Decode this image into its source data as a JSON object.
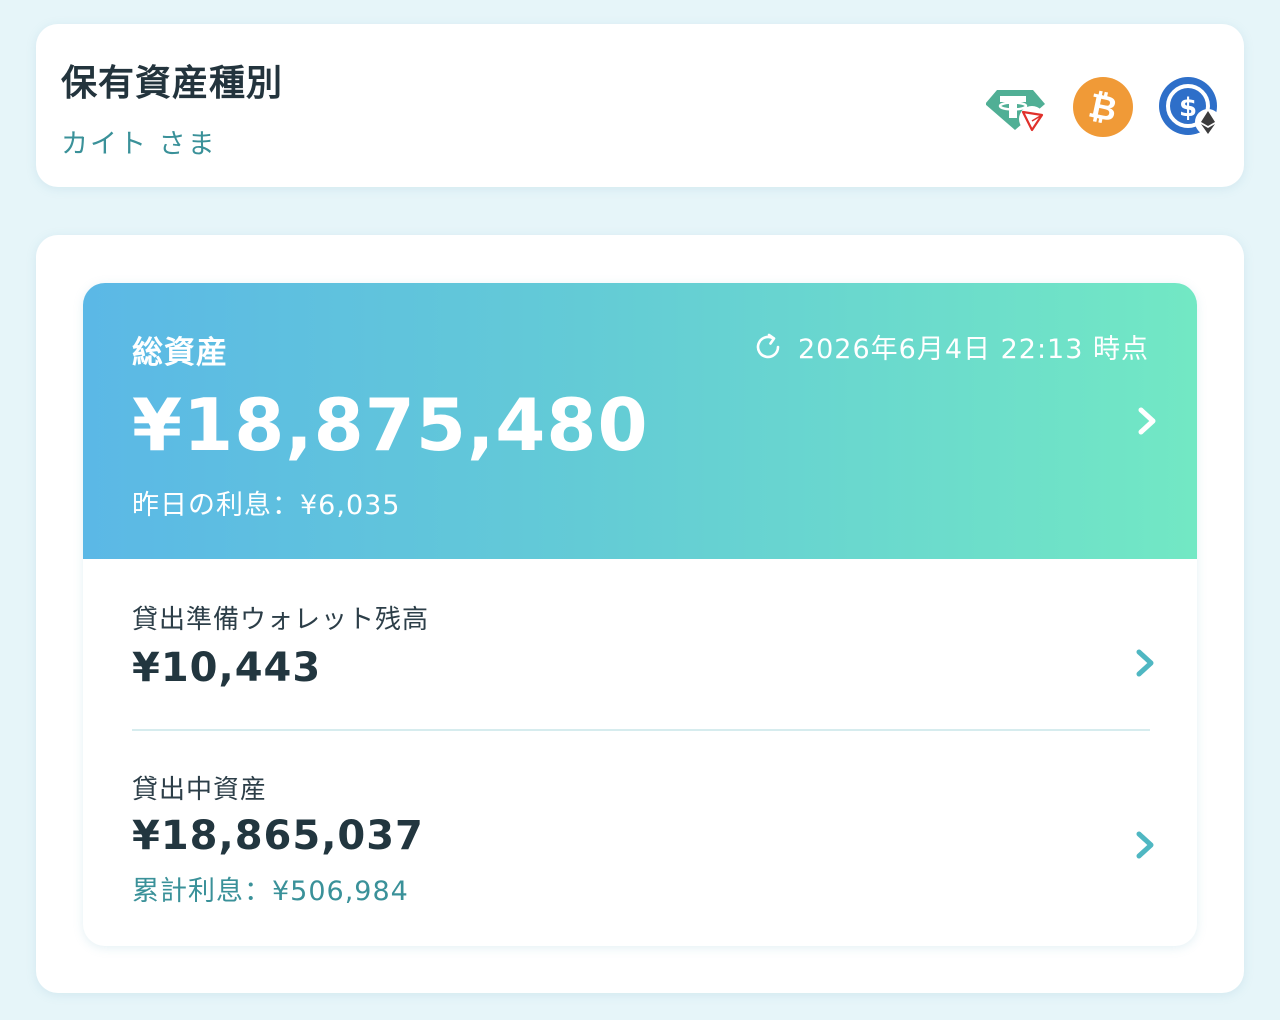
{
  "header": {
    "title": "保有資産種別",
    "user": "カイト さま",
    "coins": [
      {
        "icon": "usdt-trc20-icon",
        "color": "#50af95"
      },
      {
        "icon": "bitcoin-icon",
        "color": "#f09a37"
      },
      {
        "icon": "usdc-erc20-icon",
        "color": "#2e6fc9"
      }
    ]
  },
  "total": {
    "label": "総資産",
    "timestamp": "2026年6月4日 22:13 時点",
    "amount": "¥18,875,480",
    "yesterday_interest": "昨日の利息：¥6,035"
  },
  "reserve_wallet": {
    "label": "貸出準備ウォレット残高",
    "amount": "¥10,443"
  },
  "lending_assets": {
    "label": "貸出中資産",
    "amount": "¥18,865,037",
    "cumulative_interest": "累計利息：¥506,984"
  },
  "colors": {
    "background": "#e6f5f9",
    "gradient_start": "#5bb8e6",
    "gradient_end": "#72e8c4",
    "accent": "#3a9199",
    "chevron": "#4fb7c2"
  }
}
